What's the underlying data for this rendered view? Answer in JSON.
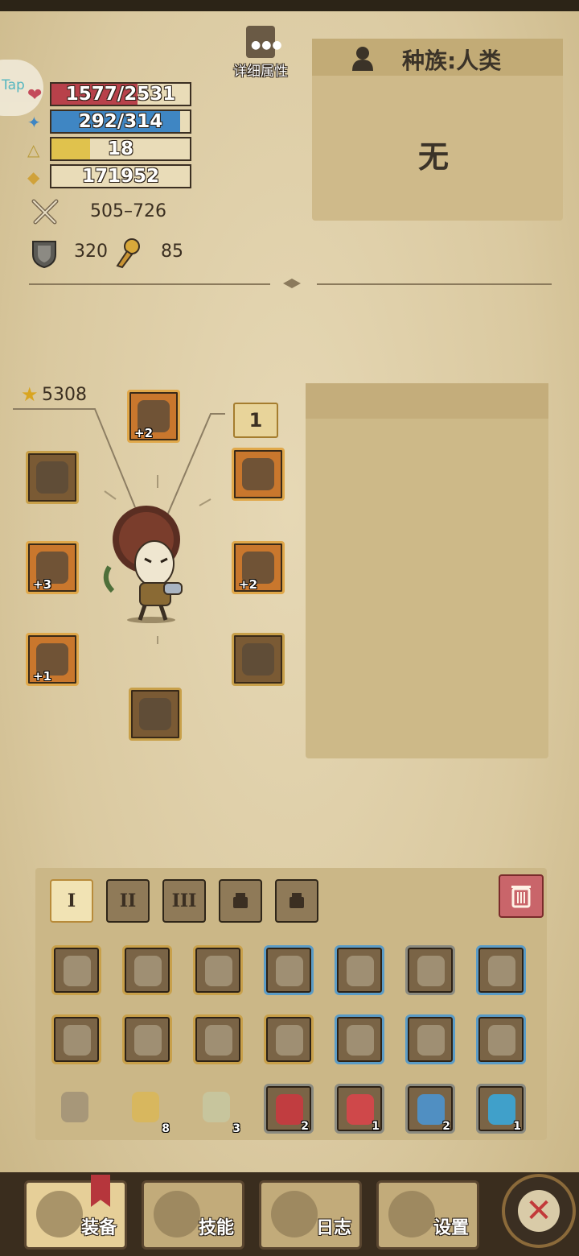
{
  "header": {
    "detail_label": "详细属性",
    "race_label": "种族:人类",
    "race_value": "无"
  },
  "bars": [
    {
      "name": "hp-bar",
      "text": "1577/2531",
      "fill": 0.623,
      "color": "#b8414a"
    },
    {
      "name": "mp-bar",
      "text": "292/314",
      "fill": 0.93,
      "color": "#3f86c3"
    },
    {
      "name": "level-bar",
      "text": "18",
      "fill": 0.28,
      "color": "#e0c24d"
    },
    {
      "name": "gold-bar",
      "text": "171952",
      "fill": 0,
      "color": "#e0c24d"
    }
  ],
  "stats": {
    "attack": "505–726",
    "defense": "320",
    "agility": "85"
  },
  "equipment": {
    "power": "5308",
    "page_badge": "1",
    "slots": [
      {
        "name": "helmet-slot",
        "plus": "+2",
        "variant": "orange"
      },
      {
        "name": "ring-slot",
        "plus": "",
        "variant": "gold"
      },
      {
        "name": "amulet-slot",
        "plus": "",
        "variant": "orange"
      },
      {
        "name": "weapon-slot",
        "plus": "+3",
        "variant": "orange"
      },
      {
        "name": "armor-slot",
        "plus": "+2",
        "variant": "orange"
      },
      {
        "name": "offhand-slot",
        "plus": "+1",
        "variant": "orange"
      },
      {
        "name": "pants-slot",
        "plus": "",
        "variant": "gold"
      },
      {
        "name": "boots-slot",
        "plus": "",
        "variant": "gold"
      }
    ]
  },
  "inventory": {
    "tabs": [
      "I",
      "II",
      "III",
      "",
      ""
    ],
    "rows": [
      [
        {
          "n": "axe",
          "c": "",
          "b": "gold"
        },
        {
          "n": "sword",
          "c": "",
          "b": "gold"
        },
        {
          "n": "crossbow",
          "c": "",
          "b": "gold"
        },
        {
          "n": "hood",
          "c": "",
          "b": "blue"
        },
        {
          "n": "leather-armor",
          "c": "",
          "b": "blue"
        },
        {
          "n": "boots",
          "c": "",
          "b": "gray"
        },
        {
          "n": "bracer",
          "c": "",
          "b": "blue"
        }
      ],
      [
        {
          "n": "gear-ring",
          "c": "",
          "b": "gold"
        },
        {
          "n": "ruby-ring",
          "c": "",
          "b": "gold"
        },
        {
          "n": "spiked-ring",
          "c": "",
          "b": "gold"
        },
        {
          "n": "dark-ring",
          "c": "",
          "b": "gold"
        },
        {
          "n": "gear-ring",
          "c": "",
          "b": "blue"
        },
        {
          "n": "gear-ring",
          "c": "",
          "b": "blue"
        },
        {
          "n": "gear-ring",
          "c": "",
          "b": "blue"
        }
      ],
      [
        {
          "n": "glasses",
          "c": "",
          "b": "none"
        },
        {
          "n": "gold-scroll",
          "c": "8",
          "b": "none"
        },
        {
          "n": "blue-scroll",
          "c": "3",
          "b": "none"
        },
        {
          "n": "red-vial",
          "c": "2",
          "b": "gray"
        },
        {
          "n": "red-potion",
          "c": "1",
          "b": "gray"
        },
        {
          "n": "blue-vial",
          "c": "2",
          "b": "gray"
        },
        {
          "n": "blue-potion",
          "c": "1",
          "b": "gray"
        }
      ]
    ]
  },
  "nav": {
    "equip": "装备",
    "skills": "技能",
    "log": "日志",
    "settings": "设置"
  }
}
